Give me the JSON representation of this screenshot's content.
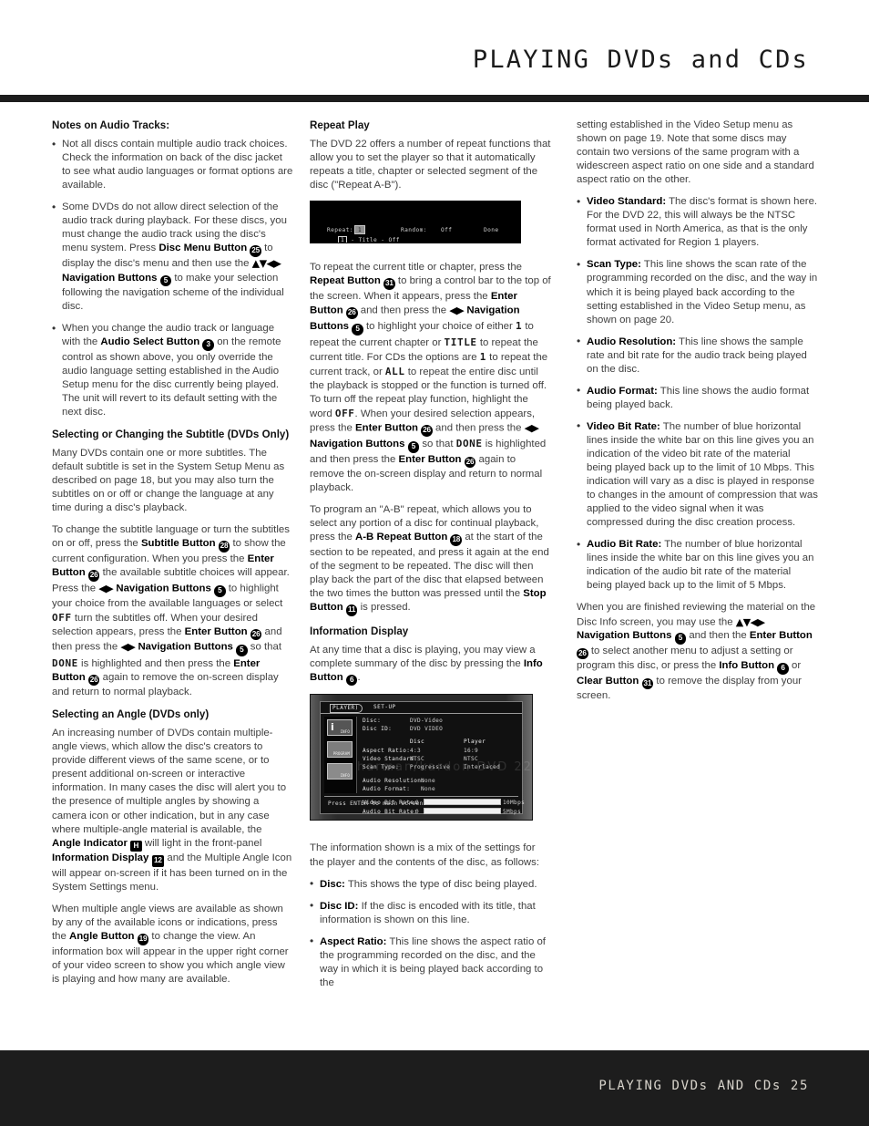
{
  "header": {
    "title": "PLAYING DVDs and CDs"
  },
  "footer": {
    "text": "PLAYING DVDs AND CDs   25"
  },
  "column1": {
    "heading_notes": "Notes on Audio Tracks:",
    "bullet1": "Not all discs contain multiple audio track choices. Check the information on back of the disc jacket to see what audio languages or format options are available.",
    "bullet2_a": "Some DVDs do not allow direct selection of the audio track during playback. For these discs, you must change the audio track using the disc's menu system. Press ",
    "bullet2_b": "Disc Menu Button",
    "bullet2_badge1": "25",
    "bullet2_c": " to display the disc's menu and then use the ",
    "bullet2_arrows": "▲▼◀▶",
    "bullet2_d": "Navigation Buttons",
    "bullet2_badge2": "5",
    "bullet2_e": " to make your selection following the navigation scheme of the individual disc.",
    "bullet3_a": "When you change the audio track or language with the ",
    "bullet3_b": "Audio Select Button",
    "bullet3_badge": "3",
    "bullet3_c": " on the remote control as shown above, you only override the audio language setting established in the Audio Setup menu for the disc currently being played. The unit will revert to its default setting with the next disc.",
    "heading_subtitle": "Selecting or Changing the Subtitle (DVDs Only)",
    "para_subtitle_1": "Many DVDs contain one or more subtitles. The default subtitle is set in the System Setup Menu as described on page 18, but you may also turn the subtitles on or off or change the language at any time during a disc's playback.",
    "p2_a": "To change the subtitle language or turn the subtitles on or off, press the ",
    "p2_b": "Subtitle Button",
    "p2_badge1": "28",
    "p2_c": " to show the current configuration. When you press the ",
    "p2_d": "Enter Button",
    "p2_badge2": "26",
    "p2_e": " the available subtitle choices will appear. Press the ",
    "p2_arrows1": "◀▶",
    "p2_f": "Navigation Buttons",
    "p2_badge3": "5",
    "p2_g": " to highlight your choice from the available languages or select ",
    "p2_mono1": "OFF",
    "p2_h": " turn the subtitles off. When your desired selection appears, press the ",
    "p2_i": "Enter Button",
    "p2_badge4": "26",
    "p2_j": " and then press the ",
    "p2_arrows2": "◀▶",
    "p2_k": "Navigation Buttons",
    "p2_badge5": "5",
    "p2_l": " so that ",
    "p2_mono2": "DONE",
    "p2_m": " is highlighted and then press the ",
    "p2_n": "Enter Button",
    "p2_badge6": "26",
    "p2_o": " again to remove the on-screen display and return to normal playback.",
    "heading_angle": "Selecting an Angle (DVDs only)",
    "p3_a": "An increasing number of DVDs contain multiple-angle views, which allow the disc's creators to provide different views of the same scene, or to present additional on-screen or interactive information. In many cases the disc will alert you to the presence of multiple angles by showing a camera icon or other indication, but in any case where multiple-angle material is available, the ",
    "p3_b": "Angle Indicator",
    "p3_badge1": "H",
    "p3_c": " will light in the front-panel ",
    "p3_d": "Information Display",
    "p3_badge2": "12",
    "p3_e": " and the Multiple Angle Icon will appear on-screen if it has been turned on in the System Settings menu.",
    "p4_a": "When multiple angle views are available as shown by any of the available icons or indications, press the ",
    "p4_b": "Angle Button",
    "p4_badge": "19",
    "p4_c": " to change the view. An information box will appear in the upper right corner of your video screen to show you which angle view is playing and how many are available."
  },
  "column2": {
    "heading_repeat": "Repeat Play",
    "para_repeat_intro": "The DVD 22 offers a number of repeat functions that allow you to set the player so that it automatically repeats a title, chapter or selected segment of the disc (\"Repeat A-B\").",
    "osd_repeat": {
      "label_repeat": "Repeat:",
      "value_repeat": "1",
      "label_random": "Random:",
      "value_random": "Off",
      "label_done": "Done",
      "sub_chip": "1",
      "sub_text": "- Title - Off"
    },
    "p1_a": "To repeat the current title or chapter, press the ",
    "p1_b": "Repeat Button",
    "p1_badge1": "31",
    "p1_c": " to bring a control bar to the top of the screen. When it appears, press the ",
    "p1_d": "Enter Button",
    "p1_badge2": "26",
    "p1_e": " and then press the ",
    "p1_arrows1": "◀▶",
    "p1_f": "Navigation Buttons",
    "p1_badge3": "5",
    "p1_g": " to highlight your choice of either ",
    "p1_mono1": "1",
    "p1_h": " to repeat the current chapter or ",
    "p1_mono2": "TITLE",
    "p1_i": " to repeat the current title. For CDs the options are ",
    "p1_mono3": "1",
    "p1_j": " to repeat the current track, or ",
    "p1_mono4": "ALL",
    "p1_k": " to repeat the entire disc until the playback is stopped or the function is turned off. To turn off the repeat play function, highlight the word ",
    "p1_mono5": "OFF",
    "p1_l": ". When your desired selection appears, press the ",
    "p1_m": "Enter Button",
    "p1_badge4": "26",
    "p1_n": " and then press the ",
    "p1_arrows2": "◀▶",
    "p1_o": "Navigation Buttons",
    "p1_badge5": "5",
    "p1_p": " so that ",
    "p1_mono6": "DONE",
    "p1_q": " is highlighted and then press the ",
    "p1_r": "Enter Button",
    "p1_badge6": "26",
    "p1_s": " again to remove the on-screen display and return to normal playback.",
    "p2_a": "To program an \"A-B\" repeat, which allows you to select any portion of a disc for continual playback, press the ",
    "p2_b": "A-B Repeat Button",
    "p2_badge1": "18",
    "p2_c": " at the start of the section to be repeated, and press it again at the end of the segment to be repeated. The disc will then play back the part of the disc that elapsed between the two times the button was pressed until the ",
    "p2_d": "Stop Button",
    "p2_badge2": "11",
    "p2_e": " is pressed.",
    "heading_info": "Information Display",
    "p3_a": "At any time that a disc is playing, you may view a complete summary of the disc by pressing the ",
    "p3_b": "Info Button",
    "p3_badge": "6",
    "p3_c": ".",
    "osd_info": {
      "tab_player": "PLAYER)",
      "tab_setup": "SET-UP",
      "label_disc": "Disc:",
      "value_disc": "DVD-Video",
      "label_disc_id": "Disc ID:",
      "value_disc_id": "DVD VIDEO",
      "colhdr_disc": "Disc",
      "colhdr_player": "Player",
      "label_aspect": "Aspect Ratio:",
      "aspect_disc": "4:3",
      "aspect_player": "16:9",
      "label_video_std": "Video Standard:",
      "video_std_disc": "NTSC",
      "video_std_player": "NTSC",
      "label_scan": "Scan Type:",
      "scan_disc": "Progressive",
      "scan_player": "Interlaced",
      "label_audio_res": "Audio Resolution:",
      "value_audio_res": "None",
      "label_audio_fmt": "Audio Format:",
      "value_audio_fmt": "None",
      "label_video_br": "Video Bit Rate:",
      "video_br_value": "0",
      "video_br_max": "10Mbps",
      "label_audio_br": "Audio Bit Rate:",
      "audio_br_value": "0",
      "audio_br_max": "5Mbps",
      "footer_hint": "Press ENTER to main screen.",
      "watermark": "harman/kardon   DVD 22"
    },
    "p4": "The information shown is a mix of the settings for the player and the contents of the disc, as follows:",
    "b1_label": "Disc:",
    "b1_text": " This shows the type of disc being played.",
    "b2_label": "Disc ID:",
    "b2_text": " If the disc is encoded with its title, that information is shown on this line.",
    "b3_label": "Aspect Ratio:",
    "b3_text": " This line shows the aspect ratio of the programming recorded on the disc, and the way in which it is being played back according to the"
  },
  "column3": {
    "cont_para": "setting established in the Video Setup menu as shown on page 19. Note that some discs may contain two versions of the same program with a widescreen aspect ratio on one side and a standard aspect ratio on the other.",
    "b1_label": "Video Standard:",
    "b1_text": " The disc's format is shown here. For the DVD 22, this will always be the NTSC format used in North America, as that is the only format activated for Region 1 players.",
    "b2_label": "Scan Type:",
    "b2_text": " This line shows the scan rate of the programming recorded on the disc, and the way in which it is being played back according to the setting established in the Video Setup menu, as shown on page 20.",
    "b3_label": "Audio Resolution:",
    "b3_text": " This line shows the sample rate and bit rate for the audio track being played on the disc.",
    "b4_label": "Audio Format:",
    "b4_text": " This line shows the audio format being played back.",
    "b5_label": "Video Bit Rate:",
    "b5_text": " The number of blue horizontal lines inside the white bar on this line gives you an indication of the video bit rate of the material being played back up to the limit of 10 Mbps. This indication will vary as a disc is played in response to changes in the amount of compression that was applied to the video signal when it was compressed during the disc creation process.",
    "b6_label": "Audio Bit Rate:",
    "b6_text": " The number of blue horizontal lines inside the white bar on this line gives you an indication of the audio bit rate of the material being played back up to the limit of 5 Mbps.",
    "p_final_a": "When you are finished reviewing the material on the Disc Info screen, you may use the ",
    "p_final_arrows": "▲▼◀▶",
    "p_final_b": "Navigation Buttons",
    "p_final_badge1": "5",
    "p_final_c": " and then the ",
    "p_final_d": "Enter Button",
    "p_final_badge2": "26",
    "p_final_e": " to select another menu to adjust a setting or program this disc, or press the ",
    "p_final_f": "Info Button",
    "p_final_badge3": "6",
    "p_final_g": " or ",
    "p_final_h": "Clear Button",
    "p_final_badge4": "31",
    "p_final_i": " to remove the display from your screen."
  }
}
